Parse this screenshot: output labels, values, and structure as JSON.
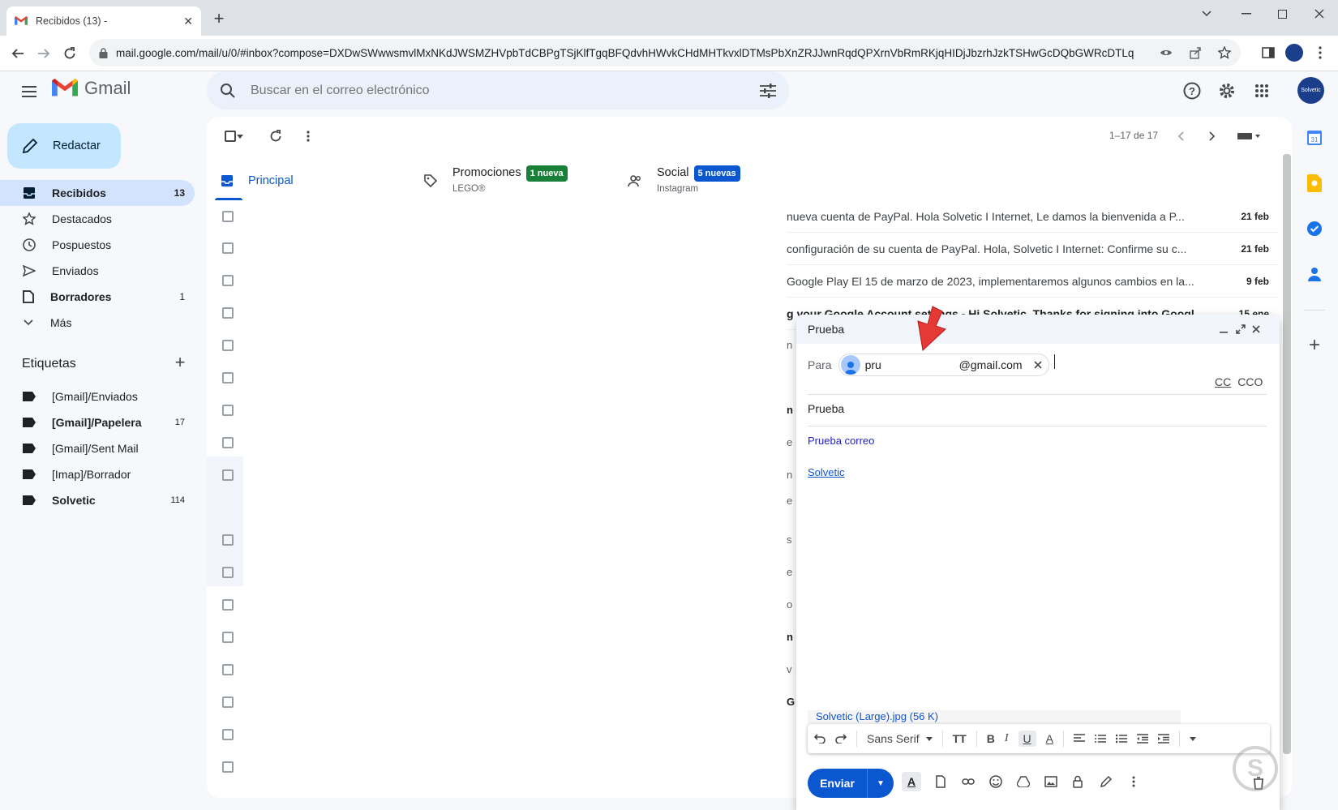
{
  "browser": {
    "tab_title": "Recibidos (13) -",
    "new_tab": "+",
    "url": "mail.google.com/mail/u/0/#inbox?compose=DXDwSWwwsmvlMxNKdJWSMZHVpbTdCBPgTSjKlfTgqBFQdvhHWvkCHdMHTkvxlDTMsPbXnZRJJwnRqdQPXrnVbRmRKjqHIDjJbzrhJzkTSHwGcDQbGWRcDTLq"
  },
  "header": {
    "app_name": "Gmail",
    "search_placeholder": "Buscar en el correo electrónico",
    "avatar_text": "Solvetic"
  },
  "compose_button": "Redactar",
  "nav": [
    {
      "label": "Recibidos",
      "count": "13",
      "active": true
    },
    {
      "label": "Destacados",
      "count": ""
    },
    {
      "label": "Pospuestos",
      "count": ""
    },
    {
      "label": "Enviados",
      "count": ""
    },
    {
      "label": "Borradores",
      "count": "1",
      "bold": true
    },
    {
      "label": "Más",
      "count": ""
    }
  ],
  "labels_title": "Etiquetas",
  "labels_add": "+",
  "labels": [
    {
      "label": "[Gmail]/Enviados",
      "count": ""
    },
    {
      "label": "[Gmail]/Papelera",
      "count": "17",
      "bold": true
    },
    {
      "label": "[Gmail]/Sent Mail",
      "count": ""
    },
    {
      "label": "[Imap]/Borrador",
      "count": ""
    },
    {
      "label": "Solvetic",
      "count": "114",
      "bold": true
    }
  ],
  "pager": "1–17 de 17",
  "categories": [
    {
      "label": "Principal",
      "sub": ""
    },
    {
      "label": "Promociones",
      "badge": "1 nueva",
      "sub": "LEGO®"
    },
    {
      "label": "Social",
      "badge": "5 nuevas",
      "sub": "Instagram"
    }
  ],
  "mails": [
    {
      "snippet": "nueva cuenta de PayPal. Hola Solvetic I Internet, Le damos la bienvenida a P...",
      "date": "21 feb"
    },
    {
      "snippet": "configuración de su cuenta de PayPal. Hola, Solvetic I Internet: Confirme su c...",
      "date": "21 feb"
    },
    {
      "snippet": "Google Play El 15 de marzo de 2023, implementaremos algunos cambios en la...",
      "date": "9 feb"
    },
    {
      "snippet": "g your Google Account settings - Hi Solvetic, Thanks for signing into Googl...",
      "date": "15 ene"
    }
  ],
  "fragments": [
    "n",
    "n",
    "e",
    "n",
    "e",
    "s",
    "e",
    "o",
    "n",
    "v",
    "G"
  ],
  "compose": {
    "title": "Prueba",
    "to_label": "Para",
    "recipient_name": "pru",
    "recipient_domain": "@gmail.com",
    "cc": "CC",
    "bcc": "CCO",
    "subject": "Prueba",
    "body_line1": "Prueba correo",
    "body_line2": "Solvetic",
    "attachment": "Solvetic (Large).jpg (56 K)",
    "font_name": "Sans Serif",
    "send": "Enviar"
  }
}
